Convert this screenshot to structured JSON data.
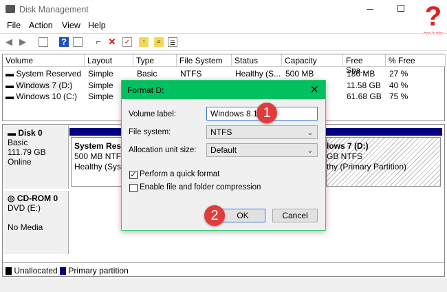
{
  "window": {
    "title": "Disk Management"
  },
  "menu": [
    "File",
    "Action",
    "View",
    "Help"
  ],
  "toolbar_icons": [
    "back-arrow-icon",
    "forward-arrow-icon",
    "console-tree-icon",
    "help-icon",
    "action-pane-icon",
    "connect-icon",
    "delete-icon",
    "properties-icon",
    "folder-up-icon",
    "folder-search-icon",
    "list-icon"
  ],
  "table": {
    "columns": [
      "Volume",
      "Layout",
      "Type",
      "File System",
      "Status",
      "Capacity",
      "Free Spa...",
      "% Free"
    ],
    "rows": [
      [
        "System Reserved",
        "Simple",
        "Basic",
        "NTFS",
        "Healthy (S...",
        "500 MB",
        "136 MB",
        "27 %"
      ],
      [
        "Windows 7 (D:)",
        "Simple",
        "",
        "",
        "",
        "",
        "11.58 GB",
        "40 %"
      ],
      [
        "Windows 10 (C:)",
        "Simple",
        "",
        "",
        "",
        "",
        "61.68 GB",
        "75 %"
      ]
    ]
  },
  "disks": [
    {
      "name": "Disk 0",
      "lines": [
        "Basic",
        "111.79 GB",
        "Online"
      ]
    },
    {
      "name": "CD-ROM 0",
      "lines": [
        "DVD (E:)",
        "",
        "No Media"
      ]
    }
  ],
  "partitions": [
    {
      "name": "System Reser",
      "size": "500 MB NTFS",
      "status": "Healthy (Syste"
    },
    {
      "name": "lows 7  (D:)",
      "size": "GB NTFS",
      "status": "thy (Primary Partition)"
    }
  ],
  "legend": [
    {
      "label": "Unallocated",
      "color": "#000000"
    },
    {
      "label": "Primary partition",
      "color": "#000080"
    }
  ],
  "dialog": {
    "title": "Format D:",
    "volume_label": "Volume label:",
    "volume_value": "Windows 8.1",
    "fs_label": "File system:",
    "fs_value": "NTFS",
    "alloc_label": "Allocation unit size:",
    "alloc_value": "Default",
    "quick_format": "Perform a quick format",
    "quick_checked": true,
    "compression": "Enable file and folder compression",
    "compression_checked": false,
    "ok": "OK",
    "cancel": "Cancel"
  },
  "badges": [
    "1",
    "2"
  ],
  "logo_text": "How To Wiki",
  "colors": {
    "dialog_header": "#00c060",
    "badge": "#e03c3c",
    "primary": "#000080"
  }
}
